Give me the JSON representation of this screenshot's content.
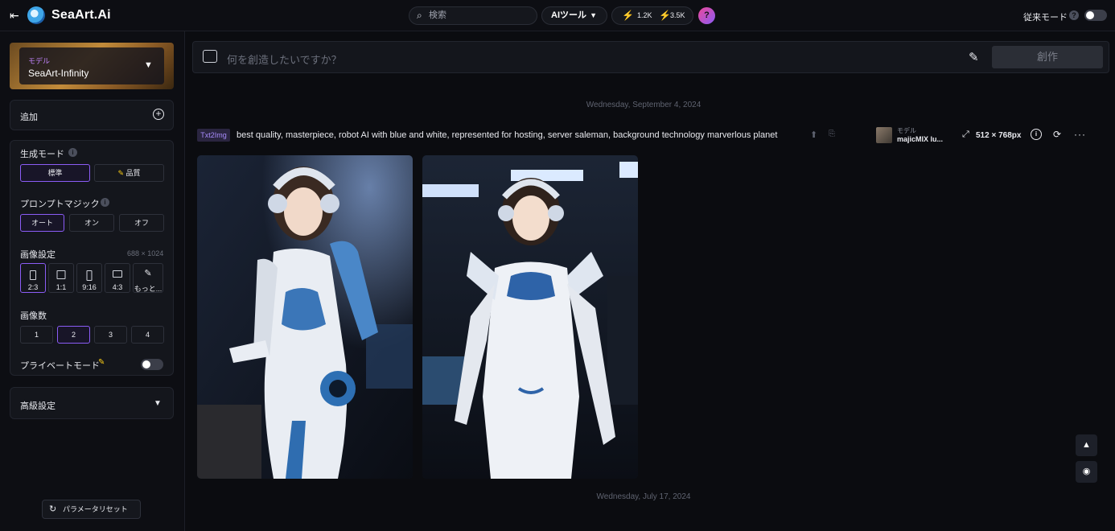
{
  "header": {
    "brand": "SeaArt.Ai",
    "search_placeholder": "検索",
    "ai_tools": "AIツール",
    "stat_power": "1.2K",
    "stat_energy": "3.5K",
    "help": "?",
    "legacy_mode": "従来モード",
    "legacy_help": "?"
  },
  "sidebar": {
    "model": {
      "label": "モデル",
      "name": "SeaArt-Infinity"
    },
    "add": "追加",
    "gen_mode": {
      "title": "生成モード",
      "options": [
        "標準",
        "品質"
      ],
      "selected": "標準"
    },
    "prompt_magic": {
      "title": "プロンプトマジック",
      "options": [
        "オート",
        "オン",
        "オフ"
      ],
      "selected": "オート"
    },
    "image_settings": {
      "title": "画像設定",
      "dims": "688 × 1024",
      "ratios": [
        "2:3",
        "1:1",
        "9:16",
        "4:3",
        "もっと..."
      ],
      "selected": "2:3"
    },
    "image_count": {
      "title": "画像数",
      "options": [
        "1",
        "2",
        "3",
        "4"
      ],
      "selected": "2"
    },
    "private_mode": "プライベートモード",
    "advanced": "高級設定",
    "reset": "パラメータリセット"
  },
  "prompt_bar": {
    "placeholder": "何を創造したいですか？",
    "create": "創作"
  },
  "feed": {
    "date1": "Wednesday, September 4, 2024",
    "tag": "Txt2Img",
    "prompt": "best quality, masterpiece, robot AI with blue and white, represented for hosting, server saleman, background technology marverlous planet",
    "model_label": "モデル",
    "model_name": "majicMIX lu...",
    "size": "512 × 768px",
    "date2": "Wednesday, July 17, 2024"
  },
  "colors": {
    "accent": "#8b5cf6",
    "bg": "#0b0c10",
    "panel": "#14161c"
  }
}
